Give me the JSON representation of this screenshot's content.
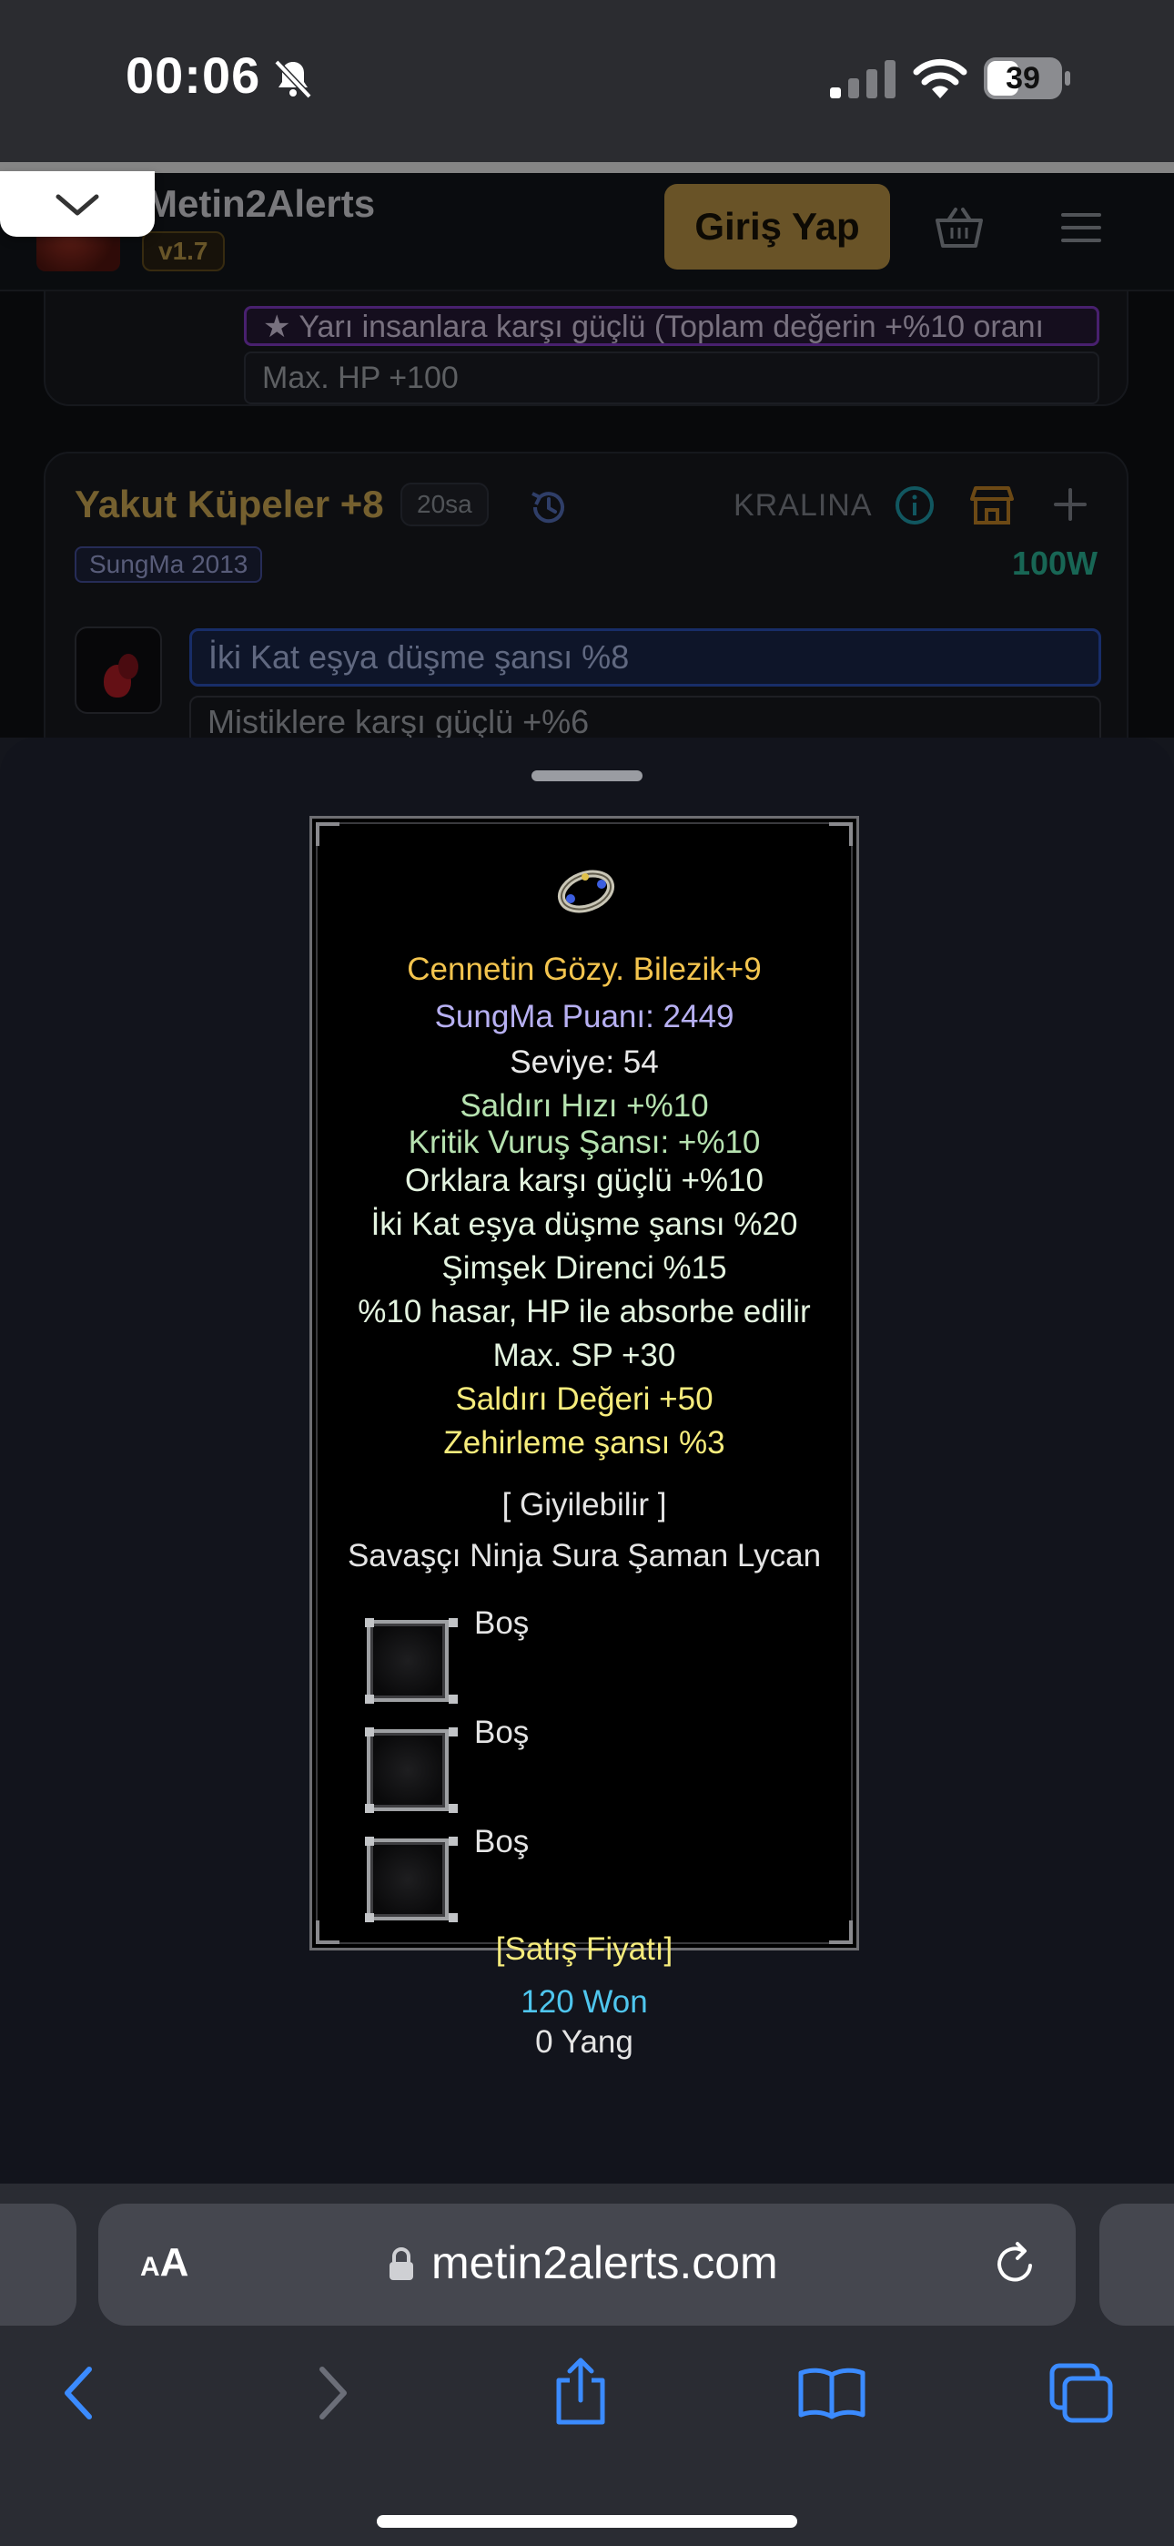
{
  "status_bar": {
    "time": "00:06",
    "battery": "39"
  },
  "site": {
    "logo_text": "Metin2Alerts",
    "version": "v1.7",
    "login_button": "Giriş Yap"
  },
  "previous_card": {
    "star_attribute": "★ Yarı insanlara karşı güçlü (Toplam değerin +%10 oranı",
    "hp_attribute": "Max. HP +100"
  },
  "listing_card": {
    "title": "Yakut Küpeler +8",
    "age_badge": "20sa",
    "seller": "KRALINA",
    "server": "SungMa 2013",
    "price": "100W",
    "attributes": [
      "İki Kat eşya düşme şansı %8",
      "Mistiklere karşı güçlü +%6"
    ]
  },
  "tooltip": {
    "name": "Cennetin Gözy. Bilezik+9",
    "points": "SungMa Puanı: 2449",
    "level": "Seviye: 54",
    "bonuses": [
      "Saldırı Hızı +%10",
      "Kritik Vuruş Şansı: +%10",
      "Orklara karşı güçlü +%10",
      "İki Kat eşya düşme şansı %20",
      "Şimşek Direnci %15",
      "%10 hasar, HP ile absorbe edilir",
      "Max. SP +30"
    ],
    "yellow_bonuses": [
      "Saldırı Değeri +50",
      "Zehirleme şansı %3"
    ],
    "wearable": "[ Giyilebilir ]",
    "classes": "Savaşçı Ninja Sura Şaman Lycan",
    "sockets": [
      "Boş",
      "Boş",
      "Boş"
    ],
    "sale_label": "[Satış Fiyatı]",
    "price_won": "120 Won",
    "price_yang": "0 Yang"
  },
  "browser": {
    "text_size_small": "A",
    "text_size_big": "A",
    "url": "metin2alerts.com"
  },
  "colors": {
    "accent_gold": "#c9a04c",
    "tooltip_name": "#f3c44e",
    "tooltip_bonus": "#b6e2b0",
    "tooltip_won": "#4fc6ee",
    "price_green": "#2ec4a4"
  },
  "icons": [
    "bell-slash-icon",
    "signal-icon",
    "wifi-icon",
    "battery-icon",
    "chevron-down-icon",
    "basket-icon",
    "hamburger-menu-icon",
    "history-icon",
    "info-icon",
    "shop-icon",
    "plus-icon",
    "bracelet-icon",
    "lock-icon",
    "reload-icon",
    "back-icon",
    "forward-icon",
    "share-icon",
    "bookmarks-icon",
    "tabs-icon"
  ]
}
